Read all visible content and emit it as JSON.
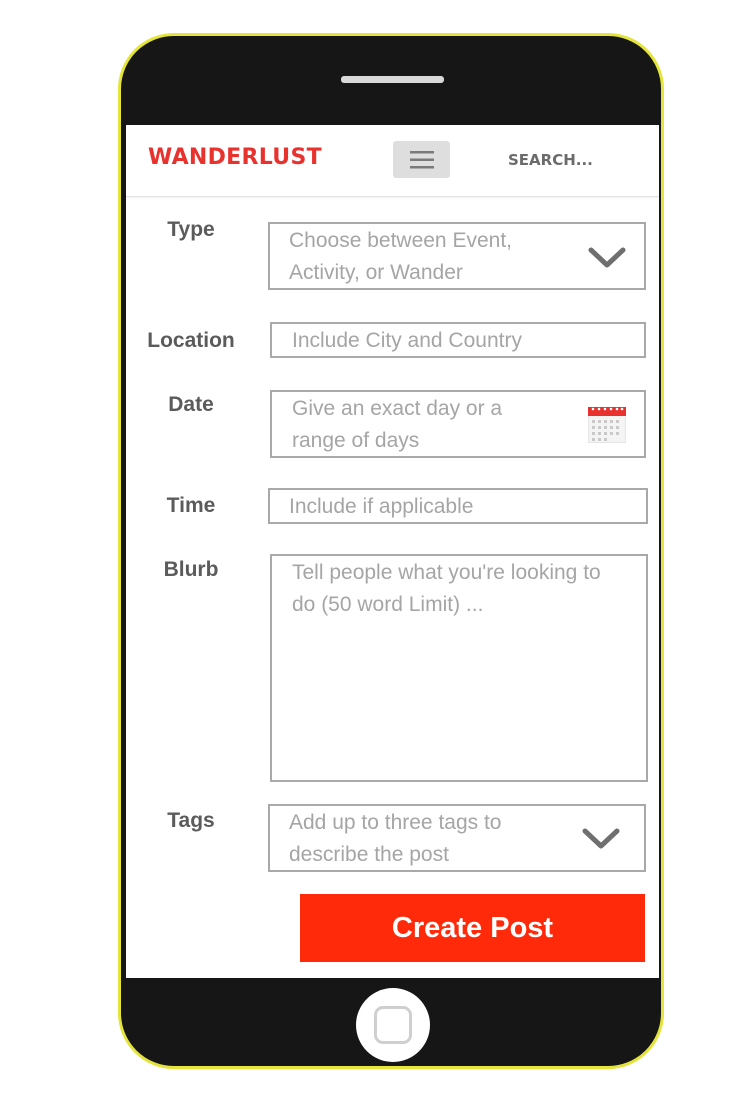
{
  "header": {
    "brand": "WANDERLUST",
    "search_label": "SEARCH..."
  },
  "form": {
    "type": {
      "label": "Type",
      "placeholder_line1": "Choose between Event,",
      "placeholder_line2": "Activity, or Wander"
    },
    "location": {
      "label": "Location",
      "placeholder": "Include City and Country"
    },
    "date": {
      "label": "Date",
      "placeholder_line1": "Give an exact day or a",
      "placeholder_line2": "range of days"
    },
    "time": {
      "label": "Time",
      "placeholder": "Include if applicable"
    },
    "blurb": {
      "label": "Blurb",
      "placeholder_line1": "Tell people what you're looking to",
      "placeholder_line2": "do (50 word Limit) ..."
    },
    "tags": {
      "label": "Tags",
      "placeholder_line1": "Add up to three tags to",
      "placeholder_line2": "describe the post"
    },
    "submit_label": "Create Post"
  },
  "colors": {
    "brand": "#e8322e",
    "primary_button": "#ff2a0a",
    "phone_body": "#161616",
    "phone_outline": "#e4e43a"
  },
  "icons": {
    "menu": "hamburger-icon",
    "dropdown": "chevron-down-icon",
    "calendar": "calendar-icon",
    "home": "home-button"
  }
}
